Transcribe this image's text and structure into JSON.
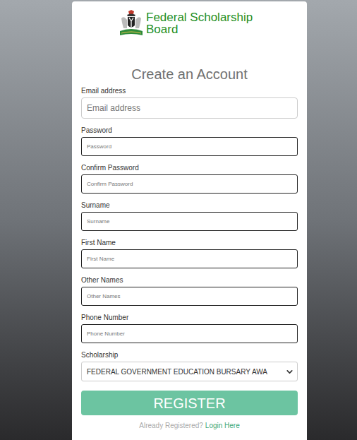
{
  "logo": {
    "lines": [
      "Federal Scholarship",
      "Board"
    ]
  },
  "heading": "Create an Account",
  "fields": [
    {
      "label": "Email address",
      "placeholder": "Email address",
      "kind": "large"
    },
    {
      "label": "Password",
      "placeholder": "Password",
      "kind": "small"
    },
    {
      "label": "Confirm Password",
      "placeholder": "Confirm Password",
      "kind": "small"
    },
    {
      "label": "Surname",
      "placeholder": "Surname",
      "kind": "small"
    },
    {
      "label": "First Name",
      "placeholder": "First Name",
      "kind": "small"
    },
    {
      "label": "Other Names",
      "placeholder": "Other Names",
      "kind": "small"
    },
    {
      "label": "Phone Number",
      "placeholder": "Phone Number",
      "kind": "small"
    }
  ],
  "scholarship": {
    "label": "Scholarship",
    "value": "FEDERAL GOVERNMENT EDUCATION BURSARY AWA"
  },
  "button": "REGISTER",
  "footer": {
    "text": "Already Registered?",
    "link": "Login Here"
  }
}
